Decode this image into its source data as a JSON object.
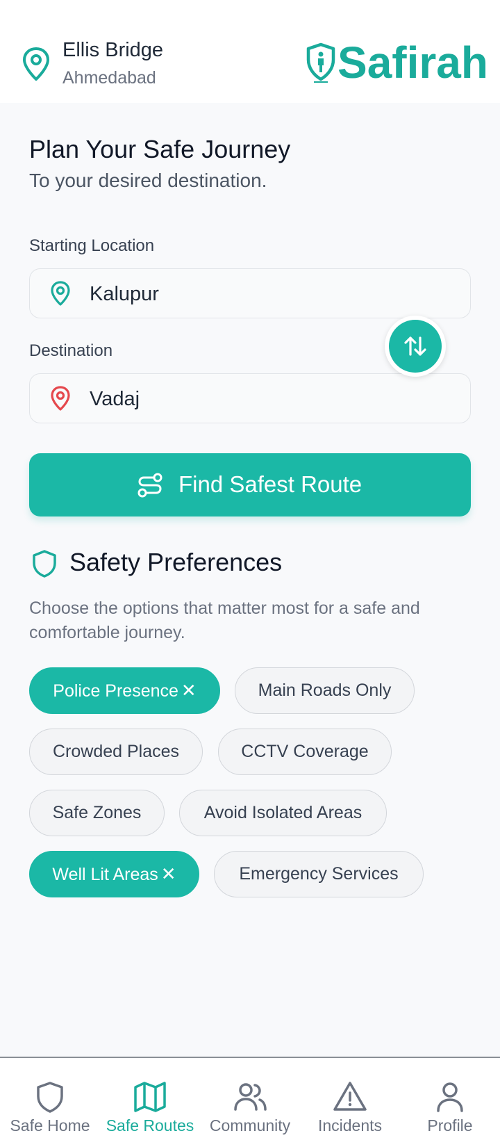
{
  "header": {
    "location_city": "Ellis Bridge",
    "location_region": "Ahmedabad",
    "logo_text": "Safirah",
    "location_icon": "map-pin-icon"
  },
  "planner": {
    "title": "Plan Your Safe Journey",
    "subtitle": "To your desired destination.",
    "start_label": "Starting Location",
    "start_value": "Kalupur",
    "destination_label": "Destination",
    "destination_value": "Vadaj",
    "swap_icon": "swap-vertical-icon",
    "find_button_label": "Find Safest Route",
    "find_button_icon": "route-icon"
  },
  "preferences": {
    "title": "Safety Preferences",
    "description": "Choose the options that matter most for a safe and comfortable journey.",
    "chips": [
      {
        "label": "Police Presence",
        "selected": true
      },
      {
        "label": "Main Roads Only",
        "selected": false
      },
      {
        "label": "Crowded Places",
        "selected": false
      },
      {
        "label": "CCTV Coverage",
        "selected": false
      },
      {
        "label": "Safe Zones",
        "selected": false
      },
      {
        "label": "Avoid Isolated Areas",
        "selected": false
      },
      {
        "label": "Well Lit Areas",
        "selected": true
      },
      {
        "label": "Emergency Services",
        "selected": false
      }
    ]
  },
  "nav": {
    "items": [
      {
        "label": "Safe Home",
        "icon": "shield-icon",
        "active": false
      },
      {
        "label": "Safe Routes",
        "icon": "map-icon",
        "active": true
      },
      {
        "label": "Community",
        "icon": "users-icon",
        "active": false
      },
      {
        "label": "Incidents",
        "icon": "alert-triangle-icon",
        "active": false
      },
      {
        "label": "Profile",
        "icon": "user-icon",
        "active": false
      }
    ]
  },
  "colors": {
    "accent": "#1bb8a6",
    "brand": "#1aab9b",
    "destination_pin": "#e5484d",
    "background": "#f8f9fb"
  }
}
